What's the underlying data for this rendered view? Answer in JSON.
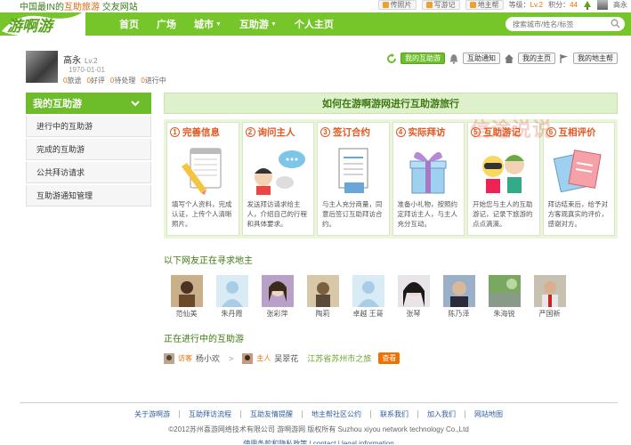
{
  "topbar": {
    "slogan_prefix": "中国最IN的",
    "slogan_highlight": "互助旅游",
    "slogan_suffix": "交友网站",
    "upload_photo": "传照片",
    "write_diary": "写游记",
    "host_help": "地主帮",
    "level_label": "等级：",
    "level_value": "Lv.2",
    "points_label": "积分：",
    "points_value": "44",
    "username": "高永"
  },
  "nav": {
    "items": [
      "首页",
      "广场",
      "城市",
      "互助游",
      "个人主页"
    ],
    "search_placeholder": "搜索城市/姓名/标签"
  },
  "profile": {
    "name": "高永",
    "level": "Lv.2",
    "birthdate": "1970-01-01",
    "stats": [
      {
        "count": "0",
        "label": "旅途"
      },
      {
        "count": "0",
        "label": "好评"
      },
      {
        "count": "0",
        "label": "待处理"
      },
      {
        "count": "0",
        "label": "进行中"
      }
    ],
    "buttons": {
      "my_trips": "我的互助游",
      "notice": "互助通知",
      "homepage": "我的主页",
      "host_help": "我的地主帮"
    }
  },
  "sidebar": {
    "title": "我的互助游",
    "items": [
      "进行中的互助游",
      "完成的互助游",
      "公共拜访请求",
      "互助游通知管理"
    ]
  },
  "guide": {
    "title": "如何在游啊游网进行互助游旅行",
    "watermark": "信途说说",
    "steps": [
      {
        "num": "1",
        "title": "完善信息",
        "desc": "填写个人资料，完成认证，上传个人清晰照片。"
      },
      {
        "num": "2",
        "title": "询问主人",
        "desc": "发送拜访请求给主人，介绍自己的行程和具体要求。"
      },
      {
        "num": "3",
        "title": "签订合约",
        "desc": "与主人充分商量，同意后签订互助拜访合约。"
      },
      {
        "num": "4",
        "title": "实际拜访",
        "desc": "准备小礼物，按照约定拜访主人，与主人充分互动。"
      },
      {
        "num": "5",
        "title": "互助游记",
        "desc": "开始您与主人的互助游记，记录下旅游的点点滴滴。"
      },
      {
        "num": "6",
        "title": "互相评价",
        "desc": "拜访结束后，给予对方客观真实的评价，感谢对方。"
      }
    ]
  },
  "seeking": {
    "title": "以下网友正在寻求地主",
    "friends": [
      "范仙美",
      "朱丹霞",
      "张彩萍",
      "陶莉",
      "卓越 王哥",
      "张琴",
      "陈乃泽",
      "朱海锐",
      "严国新"
    ]
  },
  "ongoing": {
    "title": "正在进行中的互助游",
    "visitor_role": "访客",
    "visitor_name": "杨小欢",
    "arrow": ">",
    "host_role": "主人",
    "host_name": "吴翠花",
    "route": "江苏省苏州市之旅",
    "view": "查看"
  },
  "footer": {
    "links": [
      "关于游啊游",
      "互助拜访流程",
      "互助友情提醒",
      "地主帮社区公约",
      "联系我们",
      "加入我们",
      "网站地图"
    ],
    "copyright": "©2012苏州喜游网络技术有限公司 游啊游网 版权所有  Suzhou xiyou network technology Co.,Ltd",
    "cut_text": "使用条款和隐私政策 | contact | legal information"
  },
  "colors": {
    "brand_green": "#76c52a",
    "accent_orange": "#f07000",
    "step_title": "#e2561e"
  }
}
